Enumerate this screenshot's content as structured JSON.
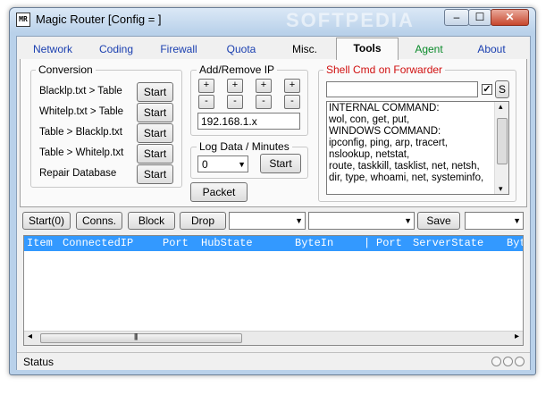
{
  "window": {
    "title": "Magic Router [Config = ]",
    "app_icon": "MR",
    "watermark": "SOFTPEDIA",
    "minimize_glyph": "–",
    "maximize_glyph": "☐",
    "close_glyph": "✕"
  },
  "tabs": [
    {
      "label": "Network"
    },
    {
      "label": "Coding"
    },
    {
      "label": "Firewall"
    },
    {
      "label": "Quota"
    },
    {
      "label": "Misc."
    },
    {
      "label": "Tools"
    },
    {
      "label": "Agent"
    },
    {
      "label": "About"
    }
  ],
  "active_tab": "Tools",
  "conversion": {
    "title": "Conversion",
    "rows": [
      {
        "label": "Blacklp.txt > Table",
        "button": "Start"
      },
      {
        "label": "Whitelp.txt > Table",
        "button": "Start"
      },
      {
        "label": "Table > Blacklp.txt",
        "button": "Start"
      },
      {
        "label": "Table > Whitelp.txt",
        "button": "Start"
      },
      {
        "label": "Repair Database",
        "button": "Start"
      }
    ]
  },
  "addremove": {
    "title": "Add/Remove IP",
    "plus": "+",
    "minus": "-",
    "ip_value": "192.168.1.x"
  },
  "logdata": {
    "title": "Log Data / Minutes",
    "value": "0",
    "button": "Start"
  },
  "packet_button": "Packet",
  "shell": {
    "title": "Shell Cmd on Forwarder",
    "input_value": "",
    "checkbox_checked": true,
    "send_button": "S",
    "lines": [
      "INTERNAL COMMAND:",
      "wol, con, get, put,",
      "WINDOWS COMMAND:",
      "ipconfig, ping, arp, tracert,",
      "nslookup, netstat,",
      "route, taskkill, tasklist, net, netsh,",
      "dir, type, whoami, net, systeminfo,"
    ]
  },
  "toolbar": {
    "start": "Start(0)",
    "conns": "Conns.",
    "block": "Block",
    "drop": "Drop",
    "save": "Save",
    "combo1": "",
    "combo2": "",
    "combo3": ""
  },
  "grid": {
    "columns": [
      "Item",
      "ConnectedIP",
      "Port",
      "HubState",
      "ByteIn",
      "|",
      "Port",
      "ServerState",
      "Byt"
    ],
    "rows": []
  },
  "status": {
    "text": "Status"
  },
  "icons": {
    "checkmark": "✓",
    "dropdown": "▼",
    "left": "◂",
    "right": "▸",
    "up": "▴",
    "down": "▾",
    "grip": "|||"
  }
}
